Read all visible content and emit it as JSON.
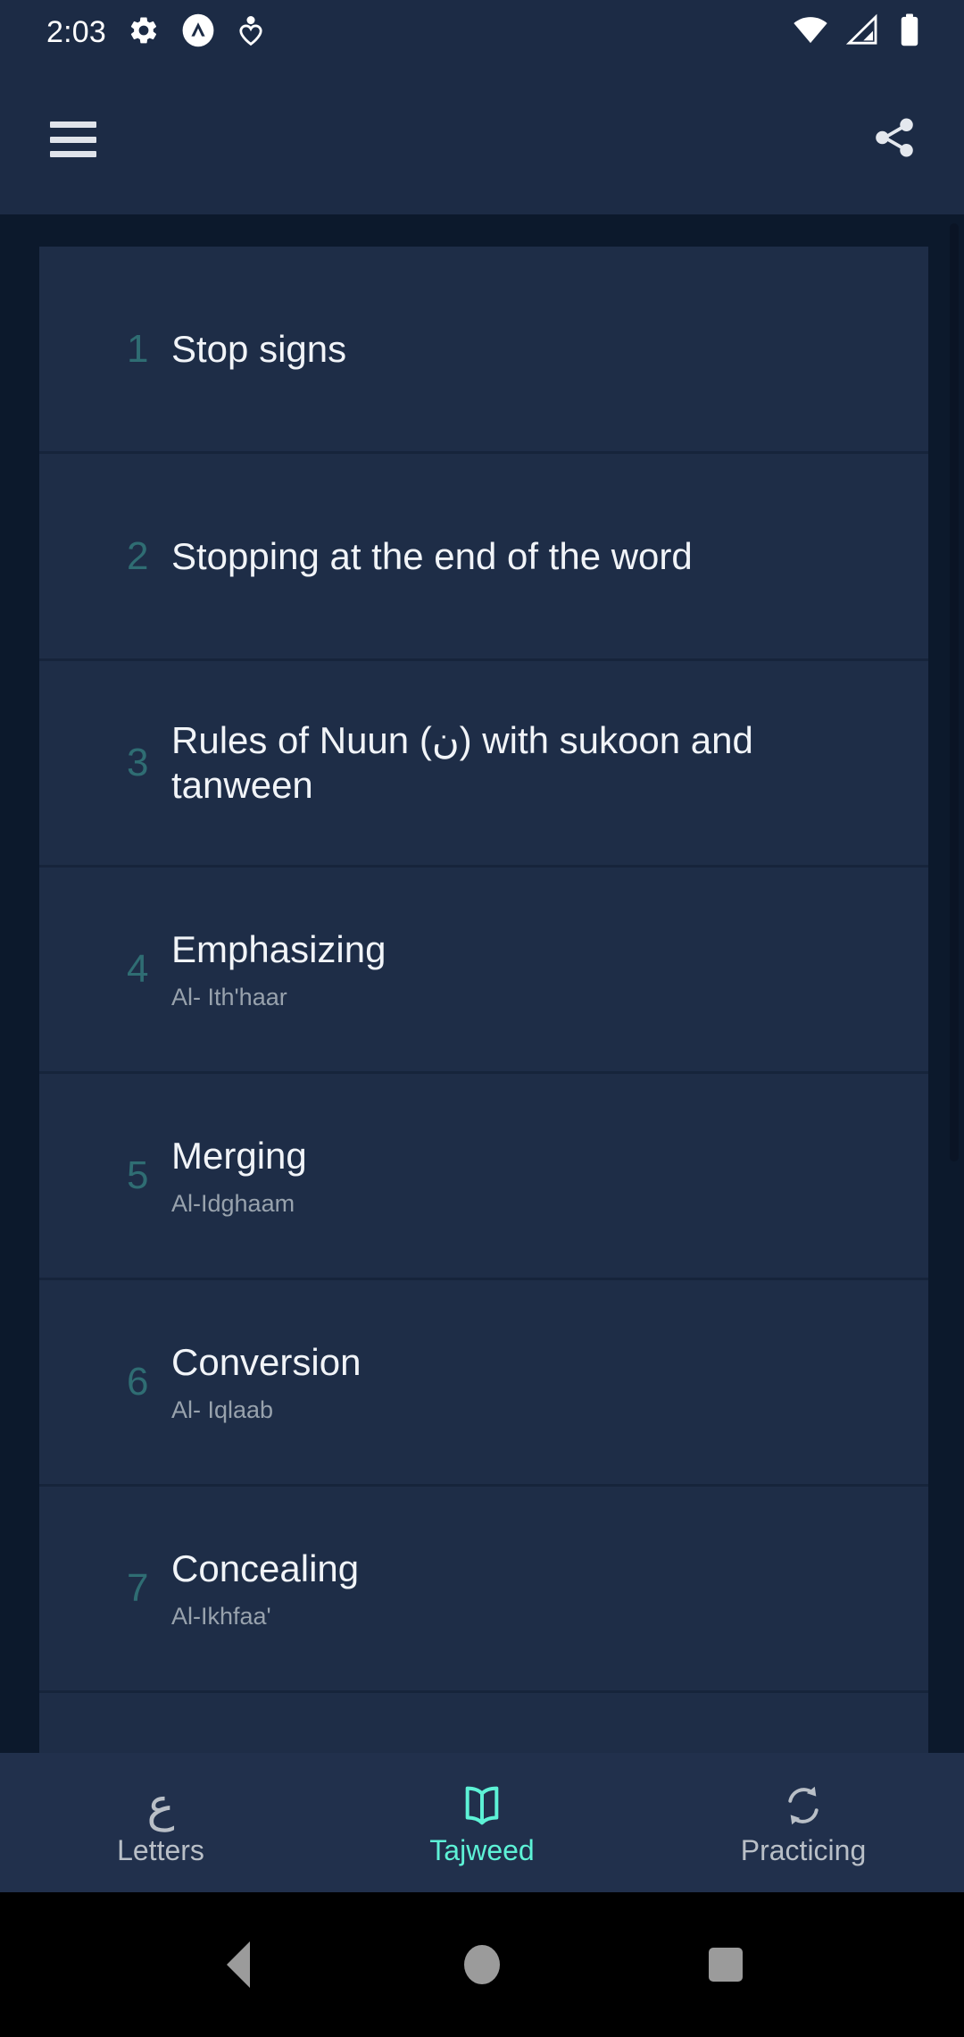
{
  "status_bar": {
    "time": "2:03",
    "left_icons": [
      "gear-icon",
      "app-logo-icon",
      "heart-person-icon"
    ],
    "right_icons": [
      "wifi-icon",
      "cellular-signal-icon",
      "battery-icon"
    ]
  },
  "app_bar": {
    "menu_icon": "hamburger-menu-icon",
    "share_icon": "share-icon"
  },
  "list": {
    "items": [
      {
        "num": "1",
        "title": "Stop signs",
        "sub": ""
      },
      {
        "num": "2",
        "title": "Stopping at the end of the word",
        "sub": ""
      },
      {
        "num": "3",
        "title": "Rules of Nuun (ن) with sukoon and tanween",
        "sub": ""
      },
      {
        "num": "4",
        "title": "Emphasizing",
        "sub": "Al- Ith'haar"
      },
      {
        "num": "5",
        "title": "Merging",
        "sub": "Al-Idghaam"
      },
      {
        "num": "6",
        "title": "Conversion",
        "sub": "Al- Iqlaab"
      },
      {
        "num": "7",
        "title": "Concealing",
        "sub": "Al-Ikhfaa'"
      }
    ]
  },
  "bottom_nav": {
    "items": [
      {
        "glyph": "ع",
        "label": "Letters",
        "icon": "arabic-ain-letter-icon",
        "active": false
      },
      {
        "glyph": "",
        "label": "Tajweed",
        "icon": "open-book-icon",
        "active": true
      },
      {
        "glyph": "",
        "label": "Practicing",
        "icon": "sync-refresh-icon",
        "active": false
      }
    ]
  },
  "system_nav": {
    "back": "back-triangle-icon",
    "home": "home-circle-icon",
    "recents": "recents-square-icon"
  },
  "colors": {
    "app_bar_bg": "#1c2b45",
    "list_bg": "#0c192c",
    "card_bg": "#1e2d47",
    "accent": "#5df2d6",
    "number_color": "#2f6d73",
    "subtitle_color": "#98a2ad"
  }
}
